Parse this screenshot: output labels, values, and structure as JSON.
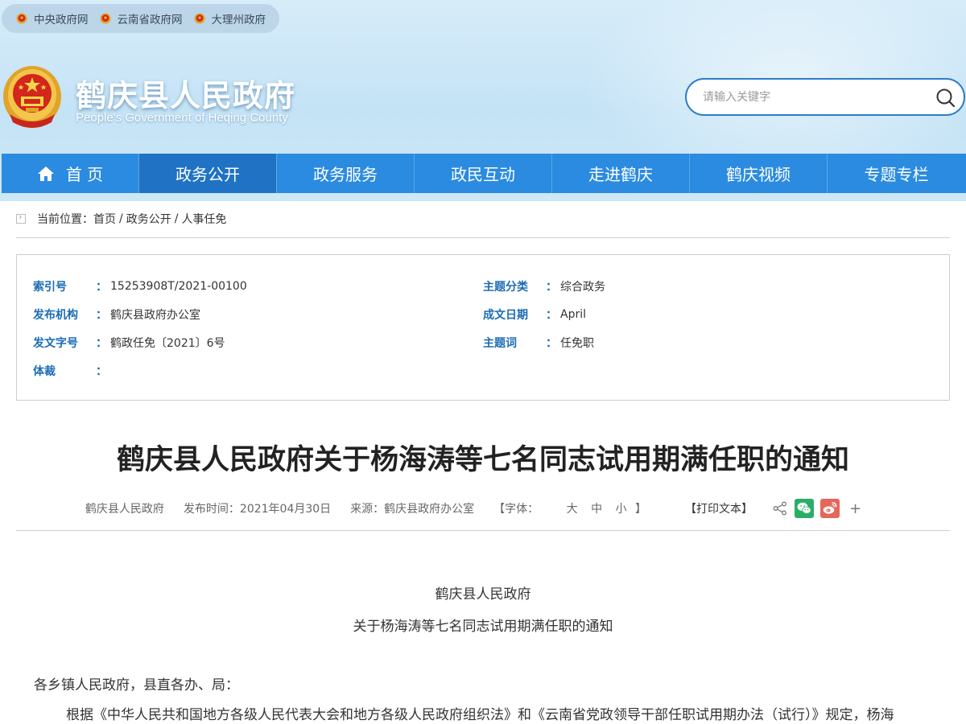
{
  "top_links": [
    "中央政府网",
    "云南省政府网",
    "大理州政府"
  ],
  "site": {
    "title": "鹤庆县人民政府",
    "subtitle": "People's Government of Heqing County"
  },
  "search": {
    "placeholder": "请输入关键字"
  },
  "nav": {
    "items": [
      {
        "label": "首 页",
        "active": false
      },
      {
        "label": "政务公开",
        "active": true
      },
      {
        "label": "政务服务",
        "active": false
      },
      {
        "label": "政民互动",
        "active": false
      },
      {
        "label": "走进鹤庆",
        "active": false
      },
      {
        "label": "鹤庆视频",
        "active": false
      },
      {
        "label": "专题专栏",
        "active": false
      }
    ]
  },
  "breadcrumb": {
    "prefix": "当前位置：",
    "items": [
      "首页",
      "政务公开",
      "人事任免"
    ]
  },
  "meta": {
    "colon": "：",
    "index_label": "索引号",
    "index_value": "15253908T/2021-00100",
    "topic_label": "主题分类",
    "topic_value": "综合政务",
    "org_label": "发布机构",
    "org_value": "鹤庆县政府办公室",
    "date_label": "成文日期",
    "date_value": "April",
    "doc_label": "发文字号",
    "doc_value": "鹤政任免〔2021〕6号",
    "keyword_label": "主题词",
    "keyword_value": "任免职",
    "genre_label": "体裁",
    "genre_value": ""
  },
  "article": {
    "title": "鹤庆县人民政府关于杨海涛等七名同志试用期满任职的通知",
    "publisher": "鹤庆县人民政府",
    "publish_time": "发布时间：2021年04月30日",
    "source": "来源：鹤庆县政府办公室",
    "font_prefix": "【字体：",
    "font_large": "大",
    "font_medium": "中",
    "font_small": "小",
    "font_suffix": "】",
    "print_label": "【打印文本】",
    "body_heading1": "鹤庆县人民政府",
    "body_heading2": "关于杨海涛等七名同志试用期满任职的通知",
    "salutation": "各乡镇人民政府，县直各办、局：",
    "paragraph1": "根据《中华人民共和国地方各级人民代表大会和地方各级人民政府组织法》和《云南省党政领导干部任职试用期办法（试行）》规定，杨海"
  },
  "colors": {
    "nav_bg": "#2b8be0",
    "nav_active": "#1f72c4",
    "meta_label": "#1a6cb5",
    "wechat": "#2aae67",
    "weibo": "#e5675c"
  },
  "icons": {
    "share": "share-icon",
    "wechat": "wechat-icon",
    "weibo": "weibo-icon",
    "more": "plus-icon",
    "more_glyph": "+"
  }
}
